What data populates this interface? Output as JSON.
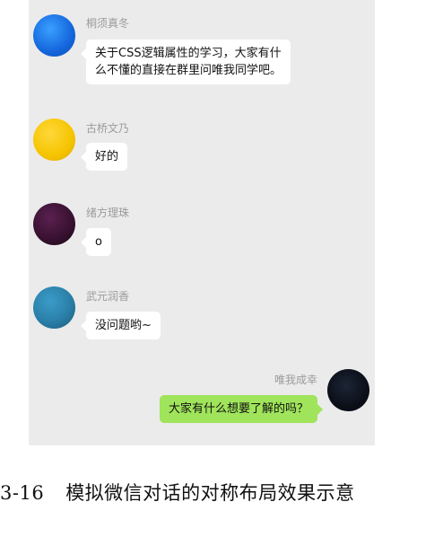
{
  "chat": {
    "messages": [
      {
        "name": "桐须真冬",
        "lines": [
          "关于CSS逻辑属性的学习，大家有什",
          "么不懂的直接在群里问唯我同学吧。"
        ],
        "avatar_color": "#1e6fe0",
        "side": "left"
      },
      {
        "name": "古桥文乃",
        "lines": [
          "好的"
        ],
        "avatar_color": "#f5c400",
        "side": "left"
      },
      {
        "name": "绪方理珠",
        "lines": [
          "o"
        ],
        "avatar_color": "#3a1232",
        "side": "left"
      },
      {
        "name": "武元润香",
        "lines": [
          "没问题哟~"
        ],
        "avatar_color": "#2a7fa8",
        "side": "left"
      },
      {
        "name": "唯我成幸",
        "lines": [
          "大家有什么想要了解的吗？"
        ],
        "avatar_color": "#0b0f18",
        "side": "right"
      }
    ],
    "colors": {
      "panel_bg": "#ebebeb",
      "bubble_left": "#ffffff",
      "bubble_right": "#9fe45a",
      "name_text": "#9b9b9b"
    }
  },
  "caption": {
    "number": "3-16",
    "text": "模拟微信对话的对称布局效果示意"
  }
}
